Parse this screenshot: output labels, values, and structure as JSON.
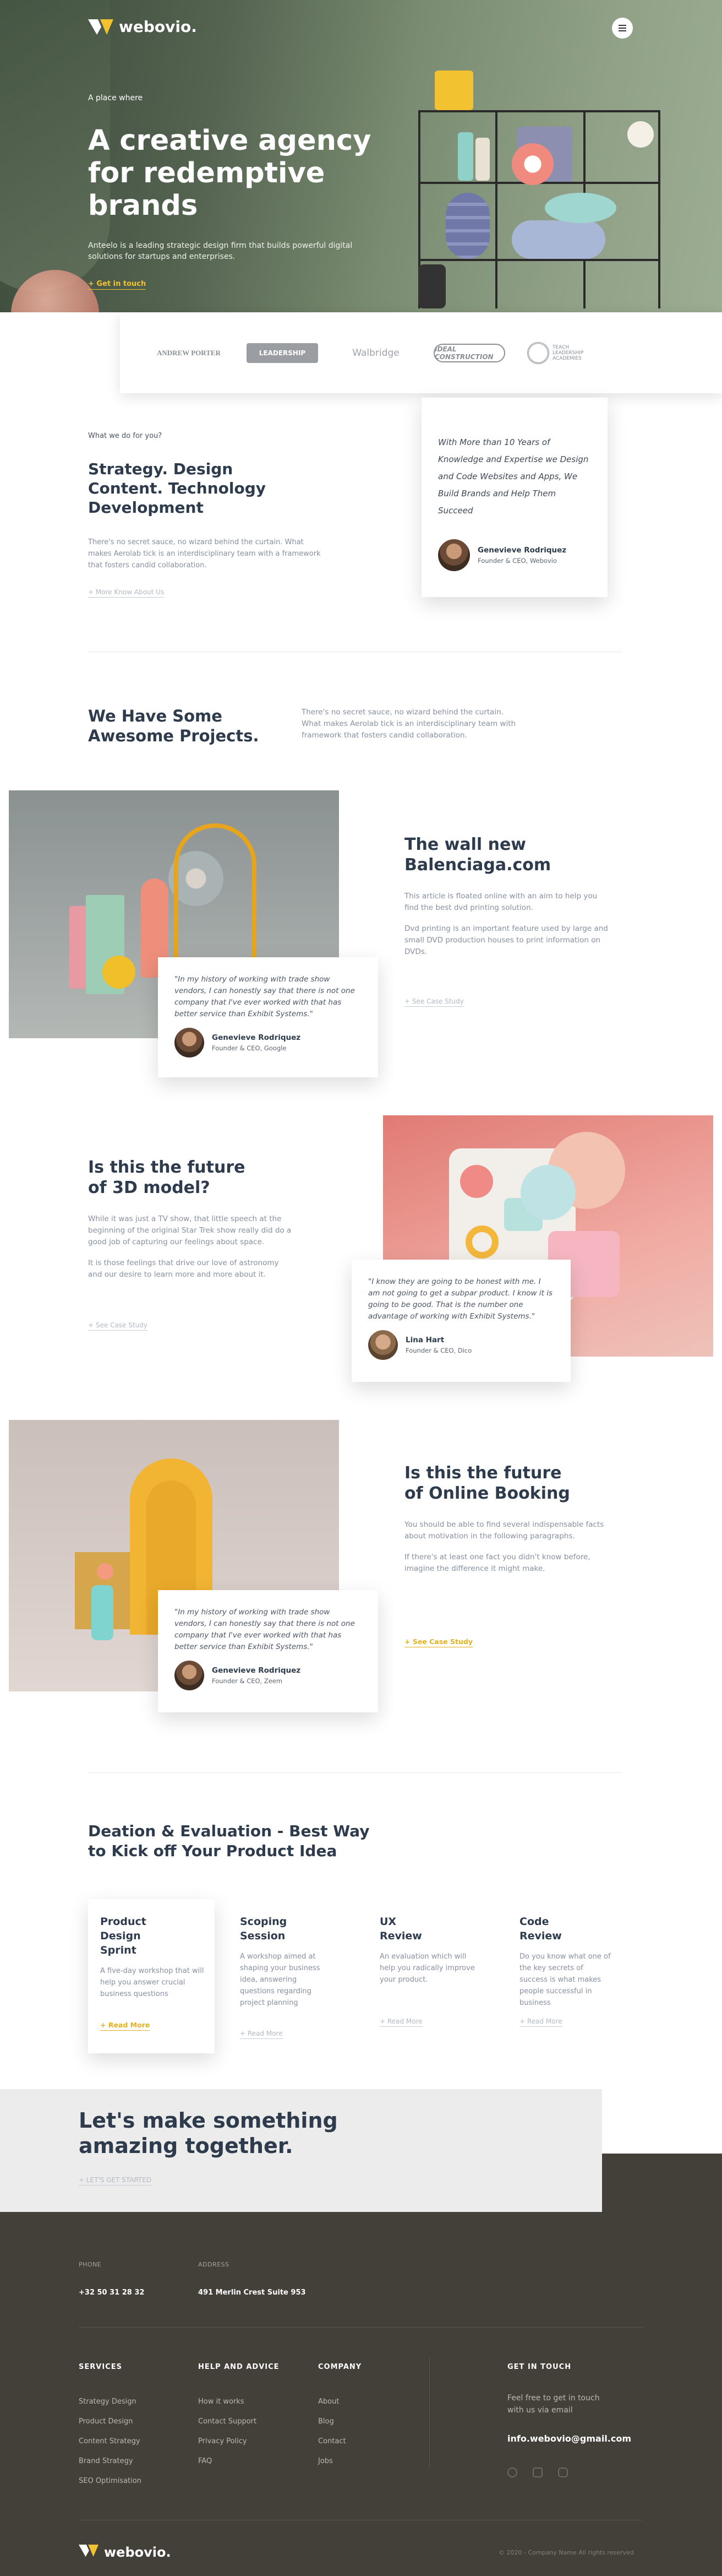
{
  "brand": {
    "name": "webovio.",
    "accent": "#f2c230"
  },
  "hero": {
    "eyebrow": "A place where",
    "title": "A creative agency for redemptive brands",
    "description": "Anteelo is a leading strategic design firm that builds powerful digital solutions for startups and enterprises.",
    "cta": "+ Get in touch",
    "menu_icon": "hamburger-icon"
  },
  "clients": [
    "ANDREW PORTER",
    "LEADERSHIP",
    "Walbridge",
    "IDEAL CONSTRUCTION",
    "TEACH LEADERSHIP ACADEMIES"
  ],
  "services_intro": {
    "eyebrow": "What we do for you?",
    "title": "Strategy. Design Content. Technology Development",
    "text": "There's no secret sauce, no wizard behind the curtain. What makes Aerolab tick is an interdisciplinary team with a framework that fosters candid collaboration.",
    "link": "+ More Know About Us"
  },
  "top_testimonial": {
    "quote": "With More than 10 Years of Knowledge and Expertise we Design and Code Websites and Apps, We Build Brands and Help Them Succeed",
    "name": "Genevieve Rodriquez",
    "role": "Founder & CEO, Webovio"
  },
  "projects_intro": {
    "title": "We Have Some Awesome Projects.",
    "text": "There's no secret sauce, no wizard behind the curtain. What makes Aerolab tick is an interdisciplinary team with framework that fosters candid collaboration."
  },
  "projects": [
    {
      "title": "The wall new Balenciaga.com",
      "p1": "This article is floated online with an aim to help you find the best dvd printing solution.",
      "p2": "Dvd printing is an important feature used by large and small DVD production houses to print information on DVDs.",
      "link": "+ See Case Study",
      "quote": "\"In my history of working with trade show vendors, I can honestly say that there is not one company that I've ever worked with that has better service than Exhibit Systems.\"",
      "name": "Genevieve Rodriquez",
      "role": "Founder & CEO, Google"
    },
    {
      "title": "Is this the future of 3D model?",
      "p1": "While it was just a TV show, that little speech at the beginning of the original Star Trek show really did do a good job of capturing our feelings about space.",
      "p2": "It is those feelings that drive our love of astronomy and our desire to learn more and more about it.",
      "link": "+ See Case Study",
      "quote": "\"I know they are going to be honest with me. I am not going to get a subpar product. I know it is going to be good. That is the number one advantage of working with Exhibit Systems.\"",
      "name": "Lina Hart",
      "role": "Founder & CEO, Dico"
    },
    {
      "title": "Is this the future of Online Booking",
      "p1": "You should be able to find several indispensable facts about motivation in the following paragraphs.",
      "p2": "If there's at least one fact you didn't know before, imagine the difference it might make.",
      "link": "+ See Case Study",
      "quote": "\"In my history of working with trade show vendors, I can honestly say that there is not one company that I've ever worked with that has better service than Exhibit Systems.\"",
      "name": "Genevieve Rodriquez",
      "role": "Founder & CEO, Zeem"
    }
  ],
  "process": {
    "title": "Deation & Evaluation - Best Way to Kick off Your Product Idea",
    "cards": [
      {
        "title": "Product Design Sprint",
        "text": "A five-day workshop that will help you answer crucial business questions",
        "link": "+ Read More"
      },
      {
        "title": "Scoping Session",
        "text": "A workshop aimed at shaping your business idea, answering questions regarding project planning",
        "link": "+ Read More"
      },
      {
        "title": "UX Review",
        "text": "An evaluation which will help you radically improve your product.",
        "link": "+ Read More"
      },
      {
        "title": "Code Review",
        "text": "Do you know what one of the key secrets of success is what makes people successful in business",
        "link": "+ Read More"
      }
    ]
  },
  "cta": {
    "title": "Let's make something amazing together.",
    "link": "+ LET'S GET STARTED"
  },
  "footer": {
    "phone_label": "PHONE",
    "phone": "+32 50 31 28 32",
    "address_label": "ADDRESS",
    "address": "491 Merlin Crest Suite 953",
    "columns": [
      {
        "head": "SERVICES",
        "items": [
          "Strategy Design",
          "Product Design",
          "Content Strategy",
          "Brand Strategy",
          "SEO Optimisation"
        ]
      },
      {
        "head": "HELP AND ADVICE",
        "items": [
          "How it works",
          "Contact Support",
          "Privacy Policy",
          "FAQ"
        ]
      },
      {
        "head": "COMPANY",
        "items": [
          "About",
          "Blog",
          "Contact",
          "Jobs"
        ]
      }
    ],
    "contact_head": "GET IN TOUCH",
    "contact_text": "Feel free to get in touch with us via email",
    "email": "info.webovio@gmail.com",
    "social_icons": [
      "facebook-icon",
      "twitter-icon",
      "instagram-icon"
    ],
    "copyright": "© 2020 - Company Name All rights reserved"
  }
}
